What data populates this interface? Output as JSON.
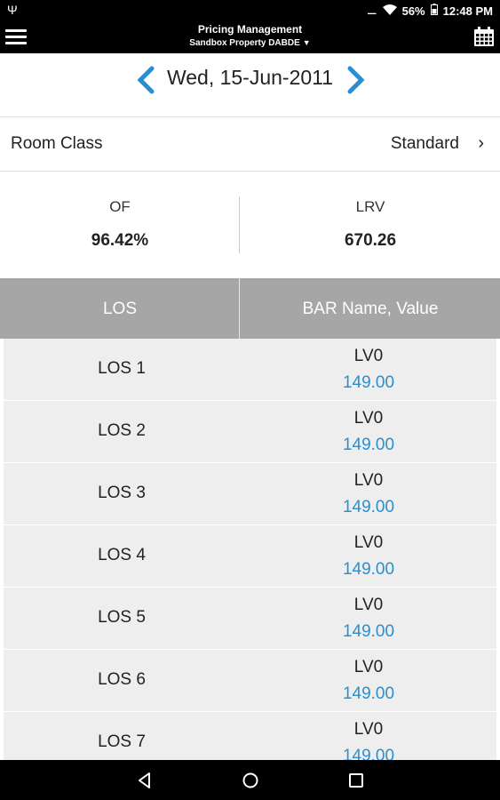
{
  "status_bar": {
    "battery": "56%",
    "time": "12:48 PM"
  },
  "app_bar": {
    "title": "Pricing Management",
    "property": "Sandbox Property DABDE"
  },
  "date_nav": {
    "date": "Wed, 15-Jun-2011"
  },
  "room_class": {
    "label": "Room Class",
    "value": "Standard"
  },
  "metrics": {
    "of_label": "OF",
    "of_value": "96.42%",
    "lrv_label": "LRV",
    "lrv_value": "670.26"
  },
  "table": {
    "headers": [
      "LOS",
      "BAR Name, Value"
    ],
    "rows": [
      {
        "los": "LOS 1",
        "bar_name": "LV0",
        "bar_value": "149.00"
      },
      {
        "los": "LOS 2",
        "bar_name": "LV0",
        "bar_value": "149.00"
      },
      {
        "los": "LOS 3",
        "bar_name": "LV0",
        "bar_value": "149.00"
      },
      {
        "los": "LOS 4",
        "bar_name": "LV0",
        "bar_value": "149.00"
      },
      {
        "los": "LOS 5",
        "bar_name": "LV0",
        "bar_value": "149.00"
      },
      {
        "los": "LOS 6",
        "bar_name": "LV0",
        "bar_value": "149.00"
      },
      {
        "los": "LOS 7",
        "bar_name": "LV0",
        "bar_value": "149.00"
      }
    ]
  },
  "colors": {
    "accent": "#2a8fd0",
    "header_bg": "#a6a6a6",
    "row_bg": "#eeeeee"
  }
}
